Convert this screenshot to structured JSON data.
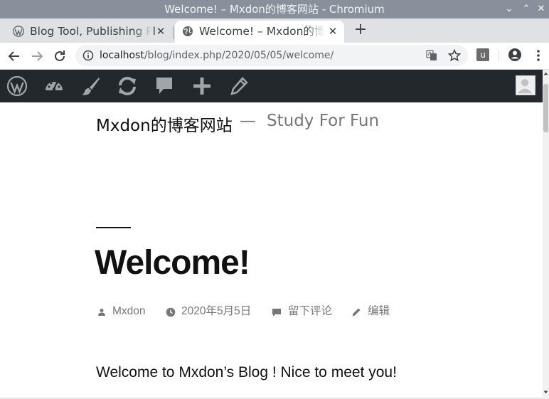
{
  "window": {
    "title": "Welcome! – Mxdon的博客网站 - Chromium"
  },
  "tabs": [
    {
      "title": "Blog Tool, Publishing Pla",
      "icon": "wordpress-icon",
      "close": "✕",
      "active": false
    },
    {
      "title": "Welcome! – Mxdon的博客",
      "icon": "globe-icon",
      "close": "✕",
      "active": true
    }
  ],
  "toolbar": {
    "new_tab": "+",
    "url_host": "localhost",
    "url_path": "/blog/index.php/2020/05/05/welcome/",
    "extension_label": "u"
  },
  "adminbar": {
    "items": [
      "wordpress-logo-icon",
      "dashboard-icon",
      "customize-brush-icon",
      "updates-icon",
      "comments-icon",
      "new-content-icon",
      "edit-icon"
    ]
  },
  "site": {
    "title": "Mxdon的博客网站",
    "separator": "—",
    "description": "Study For Fun"
  },
  "post": {
    "title": "Welcome!",
    "author": "Mxdon",
    "date": "2020年5月5日",
    "comment": "留下评论",
    "edit": "编辑",
    "body": "Welcome to Mxdon’s Blog ! Nice to meet you!"
  },
  "colors": {
    "titlebar_bg": "#87909b",
    "tabstrip_bg": "#dfe1e5",
    "adminbar_bg": "#23282d",
    "adminbar_icon": "#a0a5aa",
    "text_dark": "#111111",
    "text_meta": "#767676"
  }
}
